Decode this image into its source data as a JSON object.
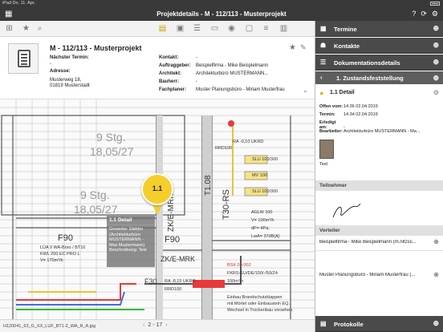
{
  "statusbar": {
    "time": "iPad  Do. 11. Apr."
  },
  "titlebar": {
    "title": "Projektdetails - M - 112/113 - Musterprojekt",
    "back_icon": "grid-icon",
    "icons": [
      "help-icon",
      "sync-icon",
      "settings-icon"
    ]
  },
  "project": {
    "title": "M - 112/113 - Musterprojekt",
    "next_appointment_label": "Nächster Termin:",
    "next_appointment_value": "-",
    "address_label": "Adresse:",
    "address_line1": "Musterweg 18,",
    "address_line2": "01819 Musterstadt",
    "fields": [
      {
        "label": "Kontakt:",
        "value": "-"
      },
      {
        "label": "Auftraggeber:",
        "value": "Beispielfirma - Mike Beispielmann"
      },
      {
        "label": "Architekt:",
        "value": "Architekturbüro MUSTERMANN..."
      },
      {
        "label": "Bauherr:",
        "value": "-"
      },
      {
        "label": "Fachplaner:",
        "value": "Muster Planungsbüro - Miriam Musterfrau"
      }
    ]
  },
  "plan": {
    "pin_label": "1.1",
    "detail_title": "1.1 Detail",
    "detail_lines": [
      "Gewerke: Elektro (Architekturbüro",
      "MUSTERMANN - Max Mustermann)",
      "Beschreibung: Test"
    ],
    "labels": {
      "stg": "9 Stg.",
      "stg_dim": "18,05/27",
      "f90_left": "F90",
      "f90_mid": "F90",
      "f30": "F30",
      "zk1": "ZK/E-MRK",
      "zk2": "ZK/E-MRK",
      "t108": "T1.08",
      "t30rs": "T30-RS",
      "slu1": "SLU 100/300",
      "slu2": "SLU 100/300",
      "mv": "MV 100",
      "aglw": "AGLW 100",
      "vflow": "V= 100m³/h",
      "dp": "dP= 4Pa;",
      "lwa": "LwA= 37dB(A)",
      "lua": "LÜA 9 WA-Büro / BT10",
      "kwl": "KWL 200 EC PRO L",
      "v170": "V= 170m³/h",
      "ra_ukrd": "RA -0,10 UKRD",
      "ra_ukro": "RA -8,15 UKRO",
      "rrd100a": "RRD100",
      "rrd100b": "RRD100",
      "bsk": "BSK 09-002",
      "fkrs": "FKRS-EU/DE/100/-/50/Z4",
      "v100": "100m³/h",
      "einbau1": "Einbau Brandschutzklappen",
      "einbau2": "mit Mörtel oder Einbaustein EQ.",
      "einbau3": "Wechsel in Trockenbau vorsehen."
    }
  },
  "bottombar": {
    "filename": "H120041_63_G_XX_LUF_BT1-2_WA_R_A.jpg",
    "page": "2 - 17"
  },
  "panel": {
    "termine": "Termine",
    "kontakte": "Kontakte",
    "dokumentation": "Dokumentationsdetails",
    "zustand": "1. Zustandsfeststellung",
    "detail_title": "1.1 Detail",
    "kv": [
      {
        "k": "Offen vom:",
        "v": "14:36 02.04.2019"
      },
      {
        "k": "Termin:",
        "v": "14:34 02.04.2019"
      },
      {
        "k": "Erledigt am:",
        "v": "-"
      },
      {
        "k": "Bearbeiter:",
        "v": "Architekturbüro MUSTERMANN - Ma..."
      }
    ],
    "photo_caption": "Test",
    "teilnehmer": "Teilnehmer",
    "verteiler": "Verteiler",
    "verteiler_items": [
      "Beispielfirma - Mike Beispielmann (m.nitzsc...",
      "Muster Planungsbüro - Miriam Musterfrau (..."
    ],
    "protokolle": "Protokolle"
  }
}
